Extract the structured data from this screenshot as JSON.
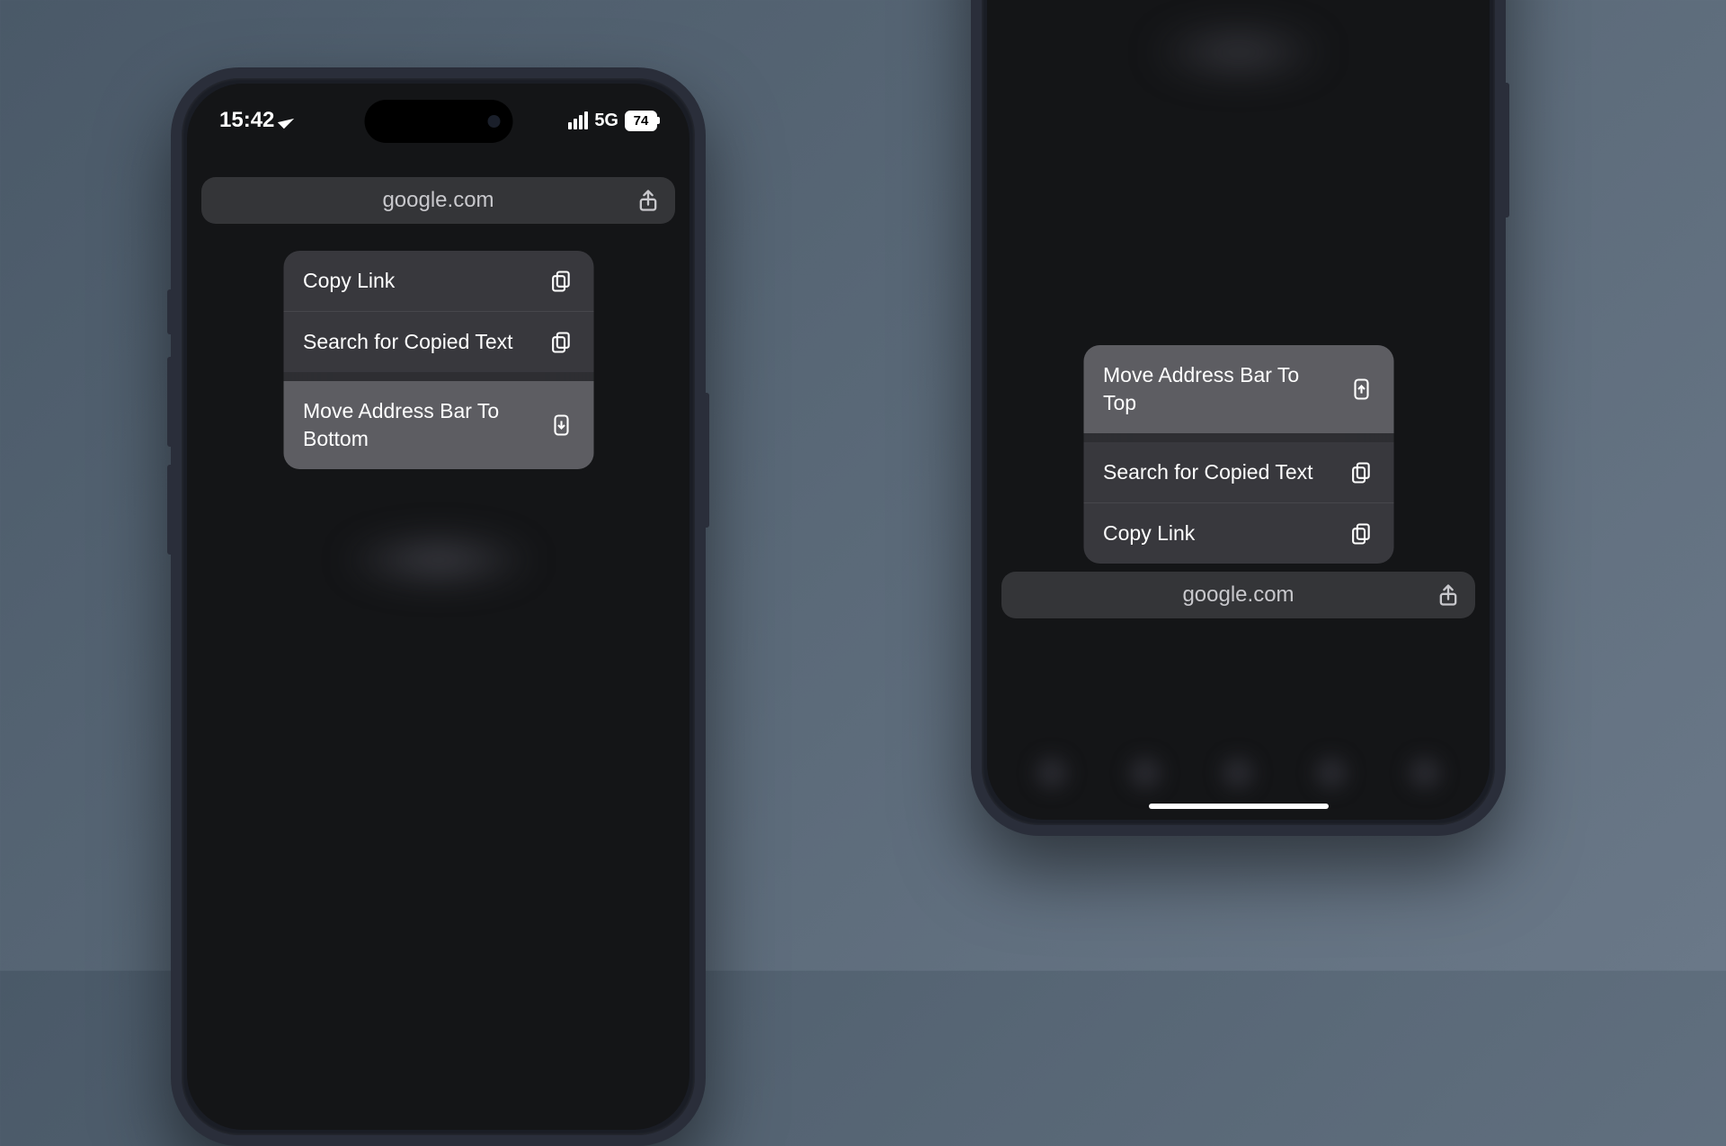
{
  "phone_left": {
    "status": {
      "time": "15:42",
      "network": "5G",
      "battery": "74"
    },
    "address_bar": {
      "url": "google.com"
    },
    "menu": {
      "copy_link": "Copy Link",
      "search_copied": "Search for Copied Text",
      "move_bar": "Move Address Bar To Bottom"
    }
  },
  "phone_right": {
    "address_bar": {
      "url": "google.com"
    },
    "menu": {
      "move_bar": "Move Address Bar To Top",
      "search_copied": "Search for Copied Text",
      "copy_link": "Copy Link"
    }
  }
}
